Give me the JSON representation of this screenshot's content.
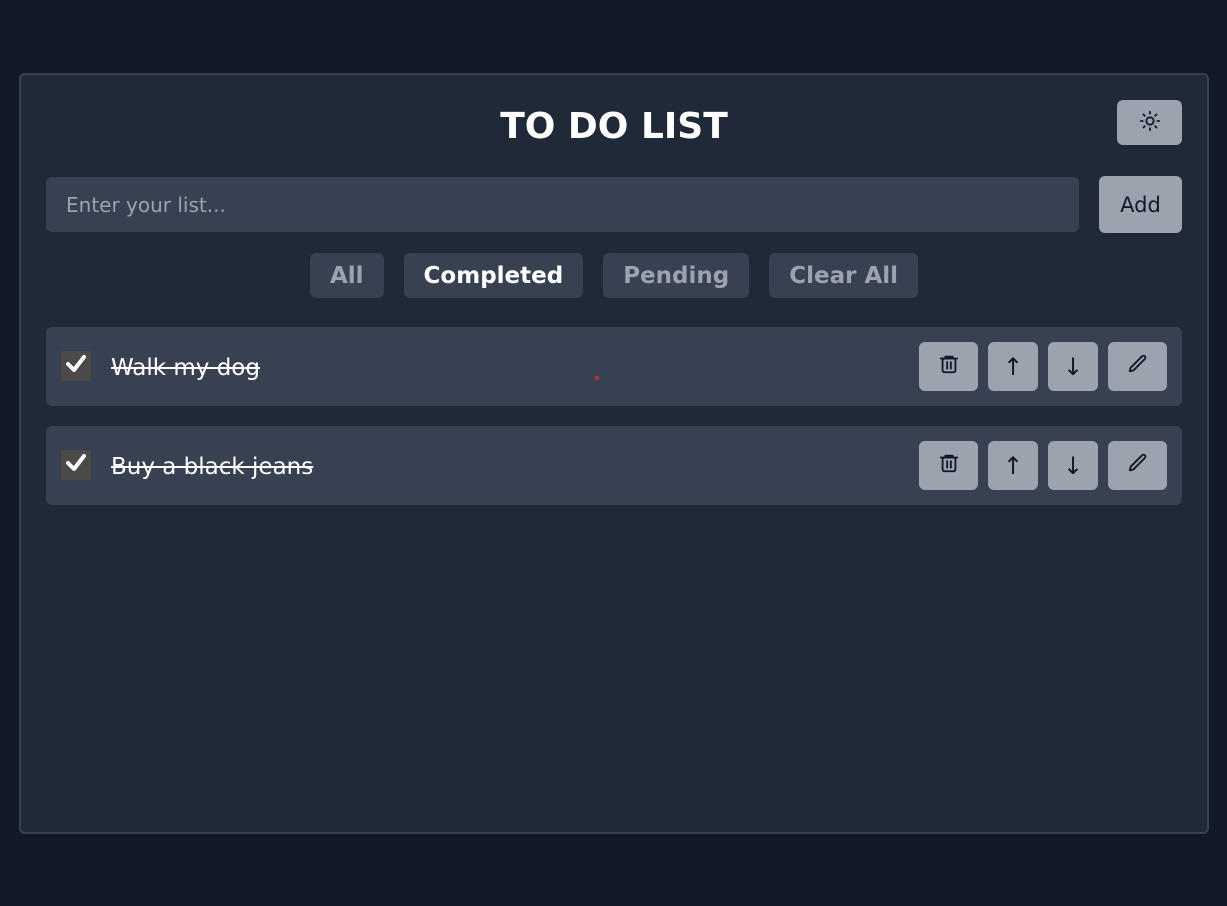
{
  "app": {
    "title": "TO DO LIST",
    "theme_toggle_icon": "sun-icon"
  },
  "input": {
    "placeholder": "Enter your list...",
    "value": "",
    "add_label": "Add"
  },
  "filters": [
    {
      "label": "All",
      "active": false
    },
    {
      "label": "Completed",
      "active": true
    },
    {
      "label": "Pending",
      "active": false
    },
    {
      "label": "Clear All",
      "active": false
    }
  ],
  "todos": [
    {
      "text": "Walk my dog",
      "completed": true
    },
    {
      "text": "Buy a black jeans",
      "completed": true
    }
  ],
  "item_actions": {
    "delete_icon": "trash-icon",
    "up_label": "↑",
    "down_label": "↓",
    "edit_icon": "pencil-icon"
  },
  "colors": {
    "background": "#111827",
    "panel": "#1f2937",
    "item": "#374151",
    "button": "#9ca3af"
  }
}
